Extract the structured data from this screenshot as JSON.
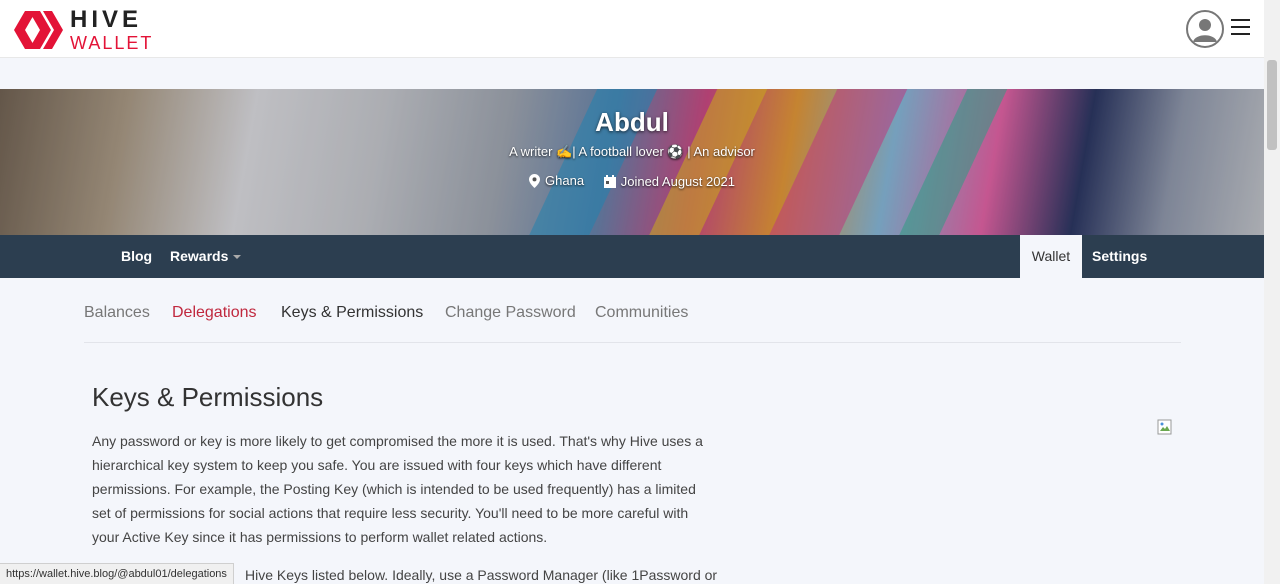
{
  "header": {
    "logo_top": "HIVE",
    "logo_bottom": "WALLET"
  },
  "profile": {
    "name": "Abdul",
    "about": "A writer ✍️| A football lover ⚽️ | An advisor",
    "location": "Ghana",
    "joined": "Joined August 2021"
  },
  "nav": {
    "blog": "Blog",
    "rewards": "Rewards",
    "wallet": "Wallet",
    "settings": "Settings"
  },
  "tabs": {
    "balances": "Balances",
    "delegations": "Delegations",
    "keys": "Keys & Permissions",
    "change_password": "Change Password",
    "communities": "Communities"
  },
  "content": {
    "title": "Keys & Permissions",
    "paragraph1": "Any password or key is more likely to get compromised the more it is used. That's why Hive uses a hierarchical key system to keep you safe. You are issued with four keys which have different permissions. For example, the Posting Key (which is intended to be used frequently) has a limited set of permissions for social actions that require less security. You'll need to be more careful with your Active Key since it has permissions to perform wallet related actions.",
    "paragraph2_visible": "Hive Keys listed below. Ideally, use a Password Manager (like 1Password or"
  },
  "status_bar": {
    "url": "https://wallet.hive.blog/@abdul01/delegations"
  },
  "icons": {
    "logo": "hive-logo-icon",
    "user": "user-avatar-icon",
    "menu": "hamburger-menu-icon",
    "location": "map-marker-icon",
    "calendar": "calendar-icon",
    "broken_image": "broken-image-icon"
  },
  "colors": {
    "brand_red": "#e31337",
    "nav_bg": "#2c3e50",
    "page_bg": "#f4f6fb",
    "active_tab_red": "#c0283e"
  }
}
